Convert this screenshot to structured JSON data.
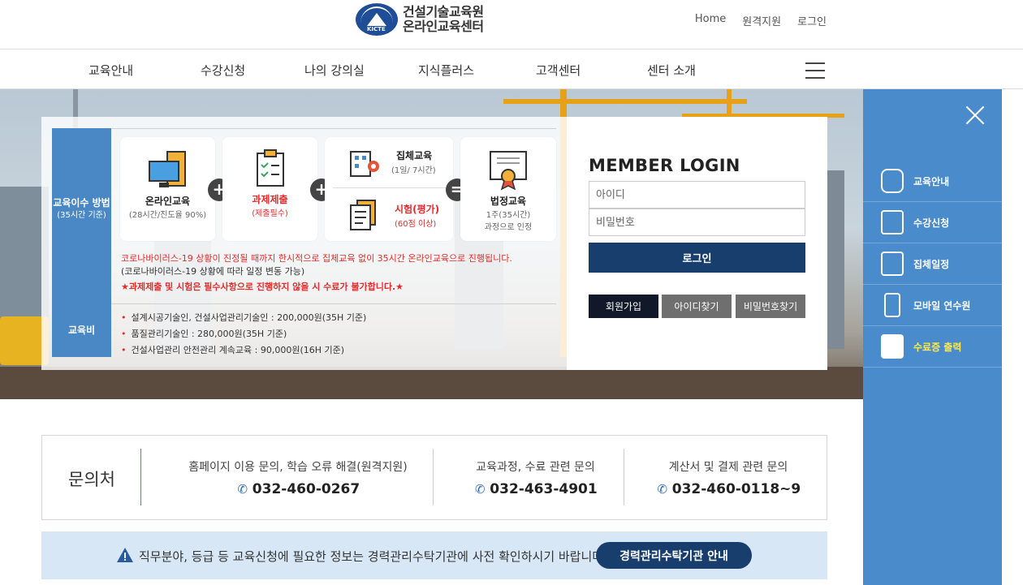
{
  "header": {
    "logo_line1": "건설기술교육원",
    "logo_line2": "온라인교육센터",
    "logo_tag": "KICTE",
    "links": [
      "Home",
      "원격지원",
      "로그인"
    ]
  },
  "nav": {
    "items": [
      "교육안내",
      "수강신청",
      "나의 강의실",
      "지식플러스",
      "고객센터",
      "센터 소개"
    ]
  },
  "edu": {
    "method_label": "교육이수 방법",
    "method_sub": "(35시간 기준)",
    "cards": {
      "online_title": "온라인교육",
      "online_sub": "(28시간/진도율 90%)",
      "task_title": "과제제출",
      "task_sub": "(제출필수)",
      "group_title": "집체교육",
      "group_sub": "(1일/ 7시간)",
      "exam_title": "시험(평가)",
      "exam_sub": "(60점 이상)",
      "legal_title": "법정교육",
      "legal_sub1": "1주(35시간)",
      "legal_sub2": "과정으로 인정"
    },
    "ops": [
      "+",
      "+",
      "="
    ],
    "note1": "코로나바이러스-19 상황이 진정될 때까지 한시적으로 집체교육 없이 35시간 온라인교육으로 진행됩니다.",
    "note2": "(코로나바이러스-19 상황에 따라 일정 변동 가능)",
    "note3": "★과제제출 및 시험은 필수사항으로 진행하지 않을 시 수료가 불가합니다.★",
    "fee_label": "교육비",
    "fees": [
      "설계시공기술인, 건설사업관리기술인 : 200,000원(35H 기준)",
      "품질관리기술인 : 280,000원(35H 기준)",
      "건설사업관리 안전관리 계속교육 : 90,000원(16H 기준)"
    ]
  },
  "login": {
    "title": "MEMBER LOGIN",
    "id_placeholder": "아이디",
    "pw_placeholder": "비밀번호",
    "submit": "로그인",
    "join": "회원가입",
    "find_id": "아이디찾기",
    "find_pw": "비밀번호찾기"
  },
  "quick": {
    "items": [
      "교육안내",
      "수강신청",
      "집체일정",
      "모바일 연수원",
      "수료증 출력"
    ]
  },
  "contact": {
    "title": "문의처",
    "blocks": [
      {
        "label": "홈페이지 이용 문의, 학습 오류 해결(원격지원)",
        "phone": "032-460-0267"
      },
      {
        "label": "교육과정, 수료 관련 문의",
        "phone": "032-463-4901"
      },
      {
        "label": "계산서 및 결제 관련 문의",
        "phone": "032-460-0118~9"
      }
    ]
  },
  "notice": {
    "message": "직무분야, 등급 등 교육신청에 필요한 정보는 경력관리수탁기관에 사전 확인하시기 바랍니다.",
    "button": "경력관리수탁기관 안내"
  },
  "colors": {
    "brand_navy": "#173e6d",
    "brand_blue": "#4a87c5",
    "quick_blue": "#4a8bcb",
    "alert_red": "#e52b2b",
    "highlight_yellow": "#ffe94a"
  }
}
